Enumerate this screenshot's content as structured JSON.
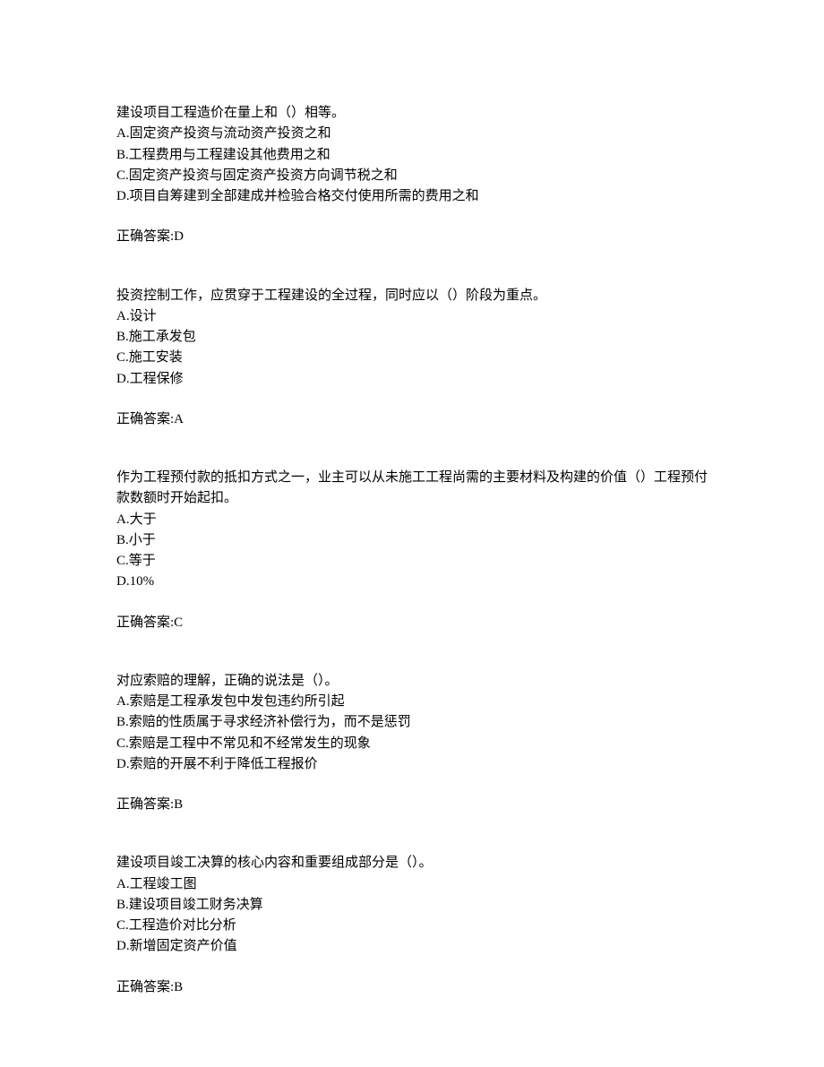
{
  "questions": [
    {
      "text": "建设项目工程造价在量上和（）相等。",
      "options": [
        "A.固定资产投资与流动资产投资之和",
        "B.工程费用与工程建设其他费用之和",
        "C.固定资产投资与固定资产投资方向调节税之和",
        "D.项目自筹建到全部建成并检验合格交付使用所需的费用之和"
      ],
      "answer": "正确答案:D"
    },
    {
      "text": "投资控制工作，应贯穿于工程建设的全过程，同时应以（）阶段为重点。",
      "options": [
        "A.设计",
        "B.施工承发包",
        "C.施工安装",
        "D.工程保修"
      ],
      "answer": "正确答案:A"
    },
    {
      "text": "作为工程预付款的抵扣方式之一，业主可以从未施工工程尚需的主要材料及构建的价值（）工程预付款数额时开始起扣。",
      "options": [
        "A.大于",
        "B.小于",
        "C.等于",
        "D.10%"
      ],
      "answer": "正确答案:C"
    },
    {
      "text": "对应索赔的理解，正确的说法是（）。",
      "options": [
        "A.索赔是工程承发包中发包违约所引起",
        "B.索赔的性质属于寻求经济补偿行为，而不是惩罚",
        "C.索赔是工程中不常见和不经常发生的现象",
        "D.索赔的开展不利于降低工程报价"
      ],
      "answer": "正确答案:B"
    },
    {
      "text": "建设项目竣工决算的核心内容和重要组成部分是（）。",
      "options": [
        "A.工程竣工图",
        "B.建设项目竣工财务决算",
        "C.工程造价对比分析",
        "D.新增固定资产价值"
      ],
      "answer": "正确答案:B"
    }
  ]
}
